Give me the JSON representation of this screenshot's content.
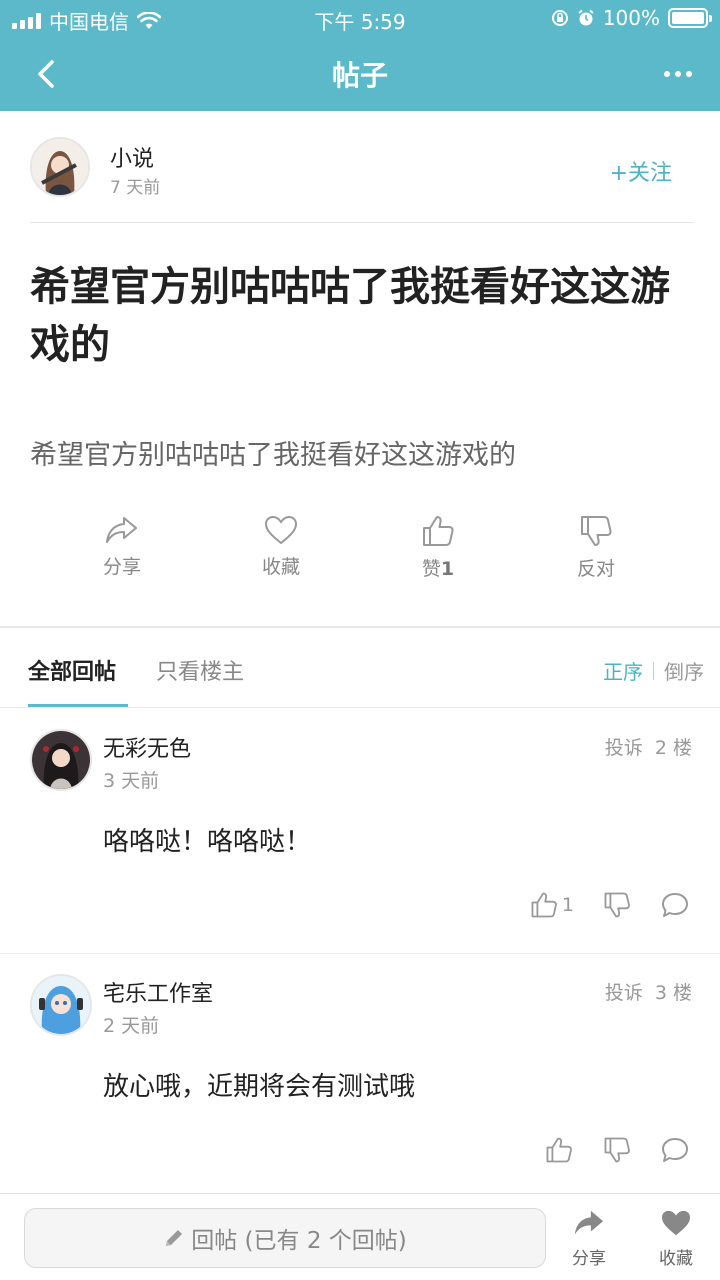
{
  "status": {
    "carrier": "中国电信",
    "time": "下午 5:59",
    "battery": "100%"
  },
  "nav": {
    "title": "帖子"
  },
  "post": {
    "author": "小说",
    "time": "7 天前",
    "follow_label": "+关注",
    "title": "希望官方别咕咕咕了我挺看好这这游戏的",
    "body": "希望官方别咕咕咕了我挺看好这这游戏的",
    "actions": {
      "share": "分享",
      "favorite": "收藏",
      "like": "赞",
      "like_count": "1",
      "dislike": "反对"
    }
  },
  "tabs": {
    "all": "全部回帖",
    "owner": "只看楼主",
    "sort_asc": "正序",
    "sort_desc": "倒序"
  },
  "replies": [
    {
      "name": "无彩无色",
      "time": "3 天前",
      "report": "投诉",
      "floor": "2 楼",
      "content": "咯咯哒！咯咯哒！",
      "likes": "1"
    },
    {
      "name": "宅乐工作室",
      "time": "2 天前",
      "report": "投诉",
      "floor": "3 楼",
      "content": "放心哦，近期将会有测试哦",
      "likes": ""
    }
  ],
  "bottom": {
    "reply_placeholder": "回帖 (已有 2 个回帖)",
    "share": "分享",
    "favorite": "收藏"
  },
  "colors": {
    "accent": "#5bb9c9",
    "accent_text": "#4db3c4"
  }
}
